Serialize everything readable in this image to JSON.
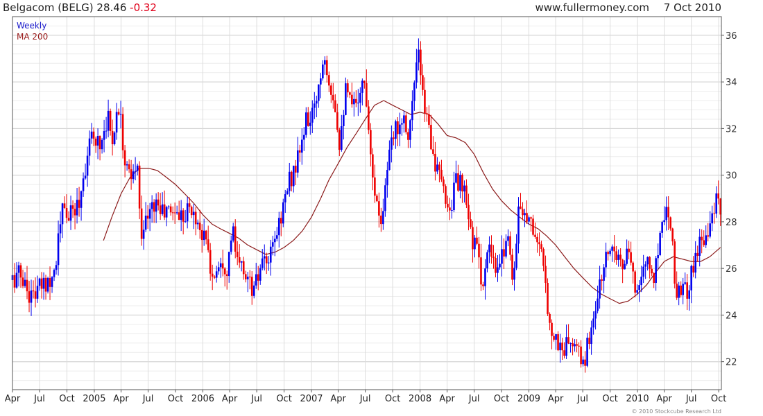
{
  "header": {
    "title": "Belgacom (BELG) 28.46",
    "change": "-0.32",
    "site": "www.fullermoney.com",
    "date": "7 Oct 2010"
  },
  "legend": {
    "series1": "Weekly",
    "series2": "MA 200"
  },
  "copyright": "© 2010 Stockcube Research Ltd",
  "colors": {
    "up": "#0000ee",
    "down": "#ee0000",
    "ma": "#8b1a1a",
    "grid": "#dcdcdc",
    "frame": "#555555"
  },
  "chart_data": {
    "type": "ohlc",
    "frequency": "weekly",
    "ylim": [
      20.8,
      36.8
    ],
    "yticks": [
      22,
      24,
      26,
      28,
      30,
      32,
      34,
      36
    ],
    "x_range": [
      "2004-04-01",
      "2010-10-10"
    ],
    "xticks": [
      {
        "date": "2004-04-01",
        "label": "Apr"
      },
      {
        "date": "2004-07-01",
        "label": "Jul"
      },
      {
        "date": "2004-10-01",
        "label": "Oct"
      },
      {
        "date": "2005-01-01",
        "label": "2005"
      },
      {
        "date": "2005-04-01",
        "label": "Apr"
      },
      {
        "date": "2005-07-01",
        "label": "Jul"
      },
      {
        "date": "2005-10-01",
        "label": "Oct"
      },
      {
        "date": "2006-01-01",
        "label": "2006"
      },
      {
        "date": "2006-04-01",
        "label": "Apr"
      },
      {
        "date": "2006-07-01",
        "label": "Jul"
      },
      {
        "date": "2006-10-01",
        "label": "Oct"
      },
      {
        "date": "2007-01-01",
        "label": "2007"
      },
      {
        "date": "2007-04-01",
        "label": "Apr"
      },
      {
        "date": "2007-07-01",
        "label": "Jul"
      },
      {
        "date": "2007-10-01",
        "label": "Oct"
      },
      {
        "date": "2008-01-01",
        "label": "2008"
      },
      {
        "date": "2008-04-01",
        "label": "Apr"
      },
      {
        "date": "2008-07-01",
        "label": "Jul"
      },
      {
        "date": "2008-10-01",
        "label": "Oct"
      },
      {
        "date": "2009-01-01",
        "label": "2009"
      },
      {
        "date": "2009-04-01",
        "label": "Apr"
      },
      {
        "date": "2009-07-01",
        "label": "Jul"
      },
      {
        "date": "2009-10-01",
        "label": "Oct"
      },
      {
        "date": "2010-01-01",
        "label": "2010"
      },
      {
        "date": "2010-04-01",
        "label": "Apr"
      },
      {
        "date": "2010-07-01",
        "label": "Jul"
      },
      {
        "date": "2010-10-01",
        "label": "Oct"
      }
    ],
    "price_path": [
      [
        "2004-04-01",
        25.5
      ],
      [
        "2004-04-25",
        25.8
      ],
      [
        "2004-06-01",
        24.8
      ],
      [
        "2004-07-15",
        25.3
      ],
      [
        "2004-08-20",
        25.9
      ],
      [
        "2004-09-15",
        28.5
      ],
      [
        "2004-10-10",
        28.2
      ],
      [
        "2004-11-10",
        28.8
      ],
      [
        "2004-12-10",
        31.0
      ],
      [
        "2005-01-01",
        31.8
      ],
      [
        "2005-01-20",
        31.3
      ],
      [
        "2005-02-15",
        32.6
      ],
      [
        "2005-03-01",
        31.5
      ],
      [
        "2005-03-20",
        32.8
      ],
      [
        "2005-04-01",
        33.0
      ],
      [
        "2005-04-10",
        30.6
      ],
      [
        "2005-05-05",
        29.7
      ],
      [
        "2005-05-25",
        30.5
      ],
      [
        "2005-06-05",
        27.6
      ],
      [
        "2005-07-01",
        28.2
      ],
      [
        "2005-07-25",
        28.9
      ],
      [
        "2005-08-20",
        28.4
      ],
      [
        "2005-09-20",
        28.5
      ],
      [
        "2005-10-20",
        28.3
      ],
      [
        "2005-11-15",
        28.6
      ],
      [
        "2005-12-15",
        28.0
      ],
      [
        "2006-01-15",
        27.0
      ],
      [
        "2006-02-01",
        25.5
      ],
      [
        "2006-03-01",
        26.5
      ],
      [
        "2006-03-25",
        26.0
      ],
      [
        "2006-04-10",
        27.8
      ],
      [
        "2006-04-25",
        26.2
      ],
      [
        "2006-05-20",
        25.9
      ],
      [
        "2006-06-20",
        25.0
      ],
      [
        "2006-07-15",
        26.0
      ],
      [
        "2006-08-15",
        26.4
      ],
      [
        "2006-09-15",
        28.0
      ],
      [
        "2006-10-15",
        29.6
      ],
      [
        "2006-11-15",
        30.6
      ],
      [
        "2006-12-15",
        32.3
      ],
      [
        "2007-01-10",
        32.6
      ],
      [
        "2007-01-25",
        34.0
      ],
      [
        "2007-02-15",
        35.2
      ],
      [
        "2007-03-01",
        34.2
      ],
      [
        "2007-03-20",
        33.2
      ],
      [
        "2007-04-05",
        31.5
      ],
      [
        "2007-04-25",
        33.6
      ],
      [
        "2007-05-20",
        32.8
      ],
      [
        "2007-06-15",
        33.8
      ],
      [
        "2007-07-01",
        33.9
      ],
      [
        "2007-07-20",
        31.0
      ],
      [
        "2007-08-10",
        28.5
      ],
      [
        "2007-08-25",
        28.2
      ],
      [
        "2007-09-15",
        30.5
      ],
      [
        "2007-10-10",
        32.0
      ],
      [
        "2007-11-05",
        32.6
      ],
      [
        "2007-11-25",
        31.8
      ],
      [
        "2007-12-10",
        33.5
      ],
      [
        "2007-12-25",
        35.3
      ],
      [
        "2008-01-10",
        33.3
      ],
      [
        "2008-02-01",
        32.0
      ],
      [
        "2008-02-25",
        30.2
      ],
      [
        "2008-03-15",
        29.5
      ],
      [
        "2008-04-10",
        28.5
      ],
      [
        "2008-05-01",
        29.8
      ],
      [
        "2008-05-25",
        29.4
      ],
      [
        "2008-06-20",
        27.5
      ],
      [
        "2008-07-15",
        26.5
      ],
      [
        "2008-07-30",
        25.2
      ],
      [
        "2008-08-20",
        26.8
      ],
      [
        "2008-09-15",
        25.6
      ],
      [
        "2008-09-30",
        26.4
      ],
      [
        "2008-10-20",
        27.6
      ],
      [
        "2008-11-10",
        25.5
      ],
      [
        "2008-12-01",
        28.9
      ],
      [
        "2008-12-25",
        28.3
      ],
      [
        "2009-01-20",
        27.6
      ],
      [
        "2009-02-15",
        26.3
      ],
      [
        "2009-03-01",
        24.8
      ],
      [
        "2009-03-15",
        23.5
      ],
      [
        "2009-04-05",
        22.8
      ],
      [
        "2009-04-25",
        22.5
      ],
      [
        "2009-05-20",
        22.9
      ],
      [
        "2009-06-15",
        22.3
      ],
      [
        "2009-07-05",
        21.9
      ],
      [
        "2009-07-25",
        23.2
      ],
      [
        "2009-08-25",
        25.1
      ],
      [
        "2009-09-20",
        26.6
      ],
      [
        "2009-10-15",
        27.1
      ],
      [
        "2009-11-10",
        26.0
      ],
      [
        "2009-12-01",
        26.7
      ],
      [
        "2009-12-20",
        25.2
      ],
      [
        "2010-01-10",
        25.6
      ],
      [
        "2010-02-05",
        26.3
      ],
      [
        "2010-02-25",
        25.5
      ],
      [
        "2010-03-20",
        27.8
      ],
      [
        "2010-04-10",
        28.7
      ],
      [
        "2010-04-25",
        28.0
      ],
      [
        "2010-05-10",
        24.8
      ],
      [
        "2010-05-25",
        25.3
      ],
      [
        "2010-06-15",
        24.9
      ],
      [
        "2010-07-01",
        25.8
      ],
      [
        "2010-07-20",
        26.8
      ],
      [
        "2010-08-15",
        27.5
      ],
      [
        "2010-09-10",
        28.2
      ],
      [
        "2010-09-25",
        28.9
      ],
      [
        "2010-10-07",
        28.46
      ]
    ],
    "ma200": [
      [
        "2005-02-01",
        27.2
      ],
      [
        "2005-03-01",
        28.2
      ],
      [
        "2005-04-01",
        29.2
      ],
      [
        "2005-05-01",
        29.9
      ],
      [
        "2005-06-01",
        30.3
      ],
      [
        "2005-07-01",
        30.3
      ],
      [
        "2005-08-01",
        30.2
      ],
      [
        "2005-09-01",
        29.9
      ],
      [
        "2005-10-01",
        29.6
      ],
      [
        "2005-11-01",
        29.2
      ],
      [
        "2005-12-01",
        28.8
      ],
      [
        "2006-01-01",
        28.3
      ],
      [
        "2006-02-01",
        27.9
      ],
      [
        "2006-03-01",
        27.7
      ],
      [
        "2006-04-01",
        27.5
      ],
      [
        "2006-05-01",
        27.3
      ],
      [
        "2006-06-01",
        27.0
      ],
      [
        "2006-07-01",
        26.8
      ],
      [
        "2006-08-01",
        26.6
      ],
      [
        "2006-09-01",
        26.7
      ],
      [
        "2006-10-01",
        26.9
      ],
      [
        "2006-11-01",
        27.2
      ],
      [
        "2006-12-01",
        27.6
      ],
      [
        "2007-01-01",
        28.2
      ],
      [
        "2007-02-01",
        29.0
      ],
      [
        "2007-03-01",
        29.8
      ],
      [
        "2007-04-01",
        30.5
      ],
      [
        "2007-05-01",
        31.2
      ],
      [
        "2007-06-01",
        31.8
      ],
      [
        "2007-07-01",
        32.4
      ],
      [
        "2007-08-01",
        33.0
      ],
      [
        "2007-09-01",
        33.2
      ],
      [
        "2007-10-01",
        33.0
      ],
      [
        "2007-11-01",
        32.8
      ],
      [
        "2007-12-01",
        32.6
      ],
      [
        "2008-01-01",
        32.7
      ],
      [
        "2008-02-01",
        32.6
      ],
      [
        "2008-03-01",
        32.2
      ],
      [
        "2008-04-01",
        31.7
      ],
      [
        "2008-05-01",
        31.6
      ],
      [
        "2008-06-01",
        31.4
      ],
      [
        "2008-07-01",
        30.9
      ],
      [
        "2008-08-01",
        30.1
      ],
      [
        "2008-09-01",
        29.4
      ],
      [
        "2008-10-01",
        28.9
      ],
      [
        "2008-11-01",
        28.5
      ],
      [
        "2008-12-01",
        28.2
      ],
      [
        "2009-01-01",
        27.9
      ],
      [
        "2009-02-01",
        27.7
      ],
      [
        "2009-03-01",
        27.4
      ],
      [
        "2009-04-01",
        27.0
      ],
      [
        "2009-05-01",
        26.5
      ],
      [
        "2009-06-01",
        26.0
      ],
      [
        "2009-07-01",
        25.6
      ],
      [
        "2009-08-01",
        25.2
      ],
      [
        "2009-09-01",
        24.9
      ],
      [
        "2009-10-01",
        24.7
      ],
      [
        "2009-11-01",
        24.5
      ],
      [
        "2009-12-01",
        24.6
      ],
      [
        "2010-01-01",
        24.9
      ],
      [
        "2010-02-01",
        25.3
      ],
      [
        "2010-03-01",
        25.8
      ],
      [
        "2010-04-01",
        26.3
      ],
      [
        "2010-05-01",
        26.5
      ],
      [
        "2010-06-01",
        26.4
      ],
      [
        "2010-07-01",
        26.3
      ],
      [
        "2010-08-01",
        26.3
      ],
      [
        "2010-09-01",
        26.5
      ],
      [
        "2010-10-07",
        26.9
      ]
    ]
  }
}
